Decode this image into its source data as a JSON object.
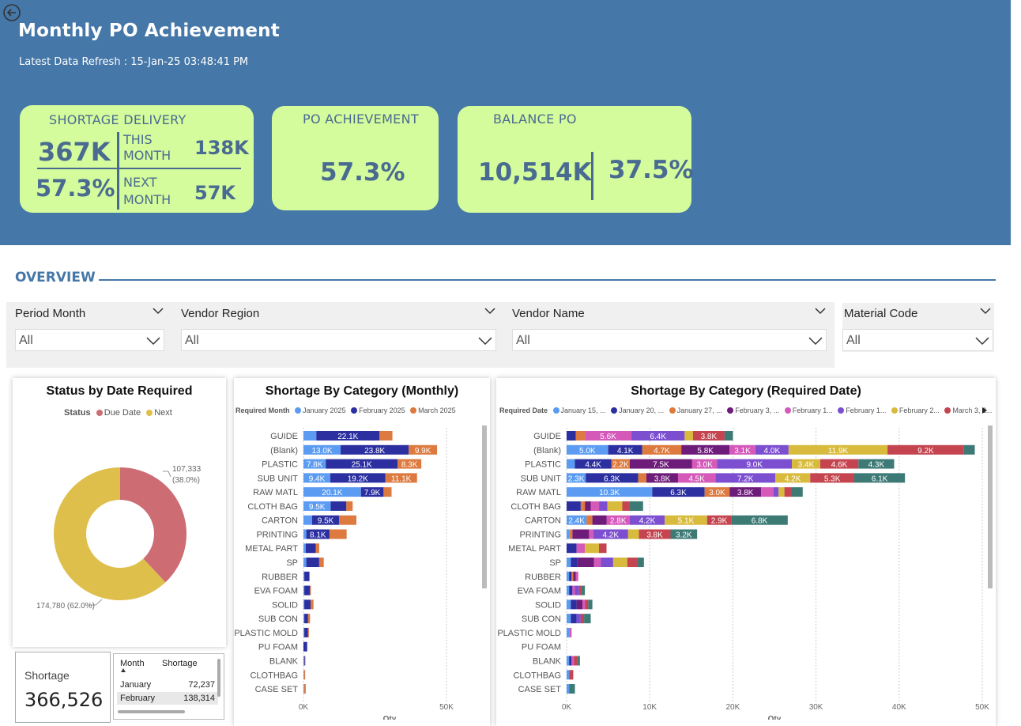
{
  "header": {
    "title": "Monthly PO Achievement",
    "refresh": "Latest Data Refresh : 15-Jan-25 03:48:41 PM"
  },
  "cards": {
    "shortage": {
      "title": "SHORTAGE DELIVERY",
      "total": "367K",
      "pct": "57.3%",
      "this_month_label_1": "THIS",
      "this_month_label_2": "MONTH",
      "this_month_value": "138K",
      "next_month_label_1": "NEXT",
      "next_month_label_2": "MONTH",
      "next_month_value": "57K"
    },
    "po_achievement": {
      "title": "PO ACHIEVEMENT",
      "value": "57.3%"
    },
    "balance_po": {
      "title": "BALANCE PO",
      "value": "10,514K",
      "pct": "37.5%"
    }
  },
  "overview": {
    "label": "OVERVIEW"
  },
  "filters": [
    {
      "label": "Period Month",
      "value": "All"
    },
    {
      "label": "Vendor Region",
      "value": "All"
    },
    {
      "label": "Vendor Name",
      "value": "All"
    },
    {
      "label": "Material Code",
      "value": "All"
    }
  ],
  "colors": {
    "header_bg": "#4577a8",
    "card_bg": "#d4fb9c",
    "due": "#cd6c73",
    "next": "#dfbf4b",
    "c1": "#5b9cf2",
    "c2": "#2b2fa0",
    "c3": "#dd7a3f",
    "c4": "#6e1c7a",
    "c5": "#d459b9",
    "c6": "#7c4fd0",
    "c7": "#d8bb3c",
    "c8": "#c4454f",
    "c9": "#3d7a76"
  },
  "status_chart": {
    "title": "Status by Date Required",
    "legend_title": "Status",
    "label_due_1": "107,333",
    "label_due_2": "(38.0%)",
    "label_next": "174,780 (62.0%)"
  },
  "monthly_chart": {
    "title": "Shortage By Category (Monthly)",
    "legend_title": "Required Month",
    "axis_title": "Qty",
    "ticks": [
      "0K",
      "50K"
    ]
  },
  "reqdate_chart": {
    "title": "Shortage By Category (Required Date)",
    "legend_title": "Required Date",
    "axis_title": "Qty",
    "ticks": [
      "0K",
      "10K",
      "20K",
      "30K",
      "40K",
      "50K"
    ]
  },
  "chart_data": [
    {
      "type": "pie",
      "title": "Status by Date Required",
      "categories": [
        "Due Date",
        "Next"
      ],
      "values": [
        107333,
        174780
      ],
      "percent": [
        38.0,
        62.0
      ]
    },
    {
      "type": "bar",
      "orientation": "horizontal",
      "stacked": true,
      "title": "Shortage By Category (Monthly)",
      "xlabel": "Qty",
      "legend_title": "Required Month",
      "xlim": [
        0,
        65000
      ],
      "categories": [
        "GUIDE",
        "(Blank)",
        "PLASTIC",
        "SUB UNIT",
        "RAW MATL",
        "CLOTH BAG",
        "CARTON",
        "PRINTING",
        "METAL PART",
        "SP",
        "RUBBER",
        "EVA FOAM",
        "SOLID",
        "SUB CON",
        "PLASTIC MOLD",
        "PU FOAM",
        "BLANK",
        "CLOTHBAG",
        "CASE SET"
      ],
      "series": [
        {
          "name": "January 2025",
          "color_key": "c1",
          "values": [
            4500,
            13000,
            7800,
            9400,
            20100,
            9500,
            3000,
            1000,
            800,
            1000,
            300,
            300,
            300,
            300,
            300,
            0,
            200,
            200,
            200
          ],
          "labels": [
            "",
            "13.0K",
            "7.8K",
            "9.4K",
            "20.1K",
            "9.5K",
            "",
            "",
            "",
            "",
            "",
            "",
            "",
            "",
            "",
            "",
            "",
            "",
            ""
          ]
        },
        {
          "name": "February 2025",
          "color_key": "c2",
          "values": [
            22100,
            23800,
            25100,
            19200,
            7900,
            5500,
            9500,
            8100,
            3500,
            4500,
            1800,
            2000,
            2200,
            1300,
            1300,
            1300,
            300,
            0,
            0
          ],
          "labels": [
            "22.1K",
            "23.8K",
            "25.1K",
            "19.2K",
            "7.9K",
            "",
            "9.5K",
            "8.1K",
            "",
            "",
            "",
            "",
            "",
            "",
            "",
            "",
            "",
            "",
            ""
          ]
        },
        {
          "name": "March 2025",
          "color_key": "c3",
          "values": [
            4500,
            9900,
            8300,
            11100,
            2800,
            2200,
            6000,
            6000,
            1200,
            1600,
            0,
            300,
            1000,
            700,
            300,
            0,
            200,
            400,
            600
          ],
          "labels": [
            "",
            "9.9K",
            "8.3K",
            "11.1K",
            "",
            "",
            "",
            "",
            "",
            "",
            "",
            "",
            "",
            "",
            "",
            "",
            "",
            "",
            ""
          ]
        }
      ]
    },
    {
      "type": "bar",
      "orientation": "horizontal",
      "stacked": true,
      "title": "Shortage By Category (Required Date)",
      "xlabel": "Qty",
      "legend_title": "Required Date",
      "xlim": [
        0,
        50000
      ],
      "categories": [
        "GUIDE",
        "(Blank)",
        "PLASTIC",
        "SUB UNIT",
        "RAW MATL",
        "CLOTH BAG",
        "CARTON",
        "PRINTING",
        "METAL PART",
        "SP",
        "RUBBER",
        "EVA FOAM",
        "SOLID",
        "SUB CON",
        "PLASTIC MOLD",
        "PU FOAM",
        "BLANK",
        "CLOTHBAG",
        "CASE SET"
      ],
      "series": [
        {
          "name": "January 15, ...",
          "color_key": "c1",
          "values": [
            0,
            5000,
            1000,
            2300,
            10300,
            0,
            2400,
            300,
            0,
            500,
            300,
            300,
            500,
            500,
            300,
            0,
            300,
            300,
            300
          ],
          "labels": [
            "",
            "5.0K",
            "",
            "2.3K",
            "10.3K",
            "",
            "2.4K",
            "",
            "",
            "",
            "",
            "",
            "",
            "",
            "",
            "",
            "",
            "",
            ""
          ]
        },
        {
          "name": "January 20, ...",
          "color_key": "c2",
          "values": [
            1100,
            4100,
            4400,
            6300,
            6300,
            1700,
            0,
            0,
            1200,
            800,
            300,
            400,
            700,
            700,
            0,
            0,
            300,
            0,
            0
          ],
          "labels": [
            "",
            "4.1K",
            "4.4K",
            "6.3K",
            "6.3K",
            "",
            "",
            "",
            "",
            "",
            "",
            "",
            "",
            "",
            "",
            "",
            "",
            "",
            ""
          ]
        },
        {
          "name": "January 27, ...",
          "color_key": "c3",
          "values": [
            1100,
            4700,
            2200,
            1000,
            3000,
            500,
            700,
            400,
            0,
            0,
            200,
            0,
            0,
            0,
            0,
            0,
            0,
            0,
            0
          ],
          "labels": [
            "",
            "4.7K",
            "2.2K",
            "",
            "3.0K",
            "",
            "",
            "",
            "",
            "",
            "",
            "",
            "",
            "",
            "",
            "",
            "",
            "",
            ""
          ]
        },
        {
          "name": "February 3, ...",
          "color_key": "c4",
          "values": [
            0,
            5800,
            7500,
            3800,
            3800,
            700,
            1700,
            2000,
            0,
            2000,
            300,
            0,
            700,
            0,
            0,
            0,
            0,
            0,
            0
          ],
          "labels": [
            "",
            "5.8K",
            "7.5K",
            "3.8K",
            "3.8K",
            "",
            "",
            "",
            "",
            "",
            "",
            "",
            "",
            "",
            "",
            "",
            "",
            "",
            ""
          ]
        },
        {
          "name": "February 1...",
          "color_key": "c5",
          "values": [
            5600,
            3100,
            3000,
            4500,
            1500,
            1000,
            2800,
            500,
            1000,
            800,
            300,
            300,
            300,
            0,
            300,
            0,
            300,
            0,
            0
          ],
          "labels": [
            "5.6K",
            "3.1K",
            "3.0K",
            "4.5K",
            "",
            "",
            "2.8K",
            "",
            "",
            "",
            "",
            "",
            "",
            "",
            "",
            "",
            "",
            "",
            ""
          ]
        },
        {
          "name": "February 1...",
          "color_key": "c6",
          "values": [
            6400,
            4000,
            9000,
            7200,
            600,
            1000,
            4200,
            4200,
            0,
            1500,
            0,
            500,
            0,
            500,
            0,
            0,
            0,
            0,
            0
          ],
          "labels": [
            "6.4K",
            "4.0K",
            "9.0K",
            "7.2K",
            "",
            "",
            "4.2K",
            "4.2K",
            "",
            "",
            "",
            "",
            "",
            "",
            "",
            "",
            "",
            "",
            ""
          ]
        },
        {
          "name": "February 2...",
          "color_key": "c7",
          "values": [
            1000,
            11900,
            3400,
            4200,
            700,
            1800,
            5100,
            1300,
            1700,
            1700,
            0,
            0,
            0,
            0,
            0,
            0,
            0,
            0,
            0
          ],
          "labels": [
            "",
            "11.9K",
            "3.4K",
            "4.2K",
            "",
            "",
            "5.1K",
            "",
            "",
            "",
            "",
            "",
            "",
            "",
            "",
            "",
            "",
            "",
            ""
          ]
        },
        {
          "name": "March 3, 2...",
          "color_key": "c8",
          "values": [
            3800,
            9200,
            4600,
            5300,
            800,
            900,
            2900,
            3800,
            900,
            1200,
            0,
            300,
            400,
            400,
            0,
            0,
            400,
            500,
            0
          ],
          "labels": [
            "3.8K",
            "9.2K",
            "4.6K",
            "5.3K",
            "",
            "",
            "2.9K",
            "3.8K",
            "",
            "",
            "",
            "",
            "",
            "",
            "",
            "",
            "",
            "",
            ""
          ]
        },
        {
          "name": "",
          "color_key": "c9",
          "values": [
            1000,
            1300,
            4300,
            6100,
            1400,
            1600,
            6800,
            3200,
            0,
            800,
            0,
            400,
            500,
            800,
            0,
            0,
            300,
            0,
            700
          ],
          "labels": [
            "",
            "",
            "4.3K",
            "6.1K",
            "",
            "",
            "6.8K",
            "3.2K",
            "",
            "",
            "",
            "",
            "",
            "",
            "",
            "",
            "",
            "",
            ""
          ]
        }
      ]
    },
    {
      "type": "table",
      "columns": [
        "Month",
        "Shortage"
      ],
      "rows": [
        [
          "January",
          "72,237"
        ],
        [
          "February",
          "138,314"
        ]
      ]
    }
  ],
  "kpi": {
    "label": "Shortage",
    "value": "366,526"
  },
  "month_table": {
    "col1": "Month",
    "col2": "Shortage",
    "rows": [
      {
        "month": "January",
        "value": "72,237"
      },
      {
        "month": "February",
        "value": "138,314"
      }
    ]
  }
}
